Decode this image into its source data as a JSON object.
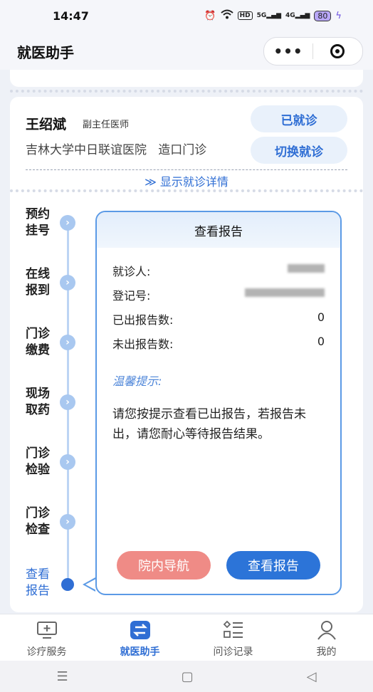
{
  "status_bar": {
    "time": "14:47",
    "hd": "HD",
    "net1": "5G",
    "net2": "4G",
    "battery": "80"
  },
  "nav": {
    "title": "就医助手",
    "more": "•••"
  },
  "doctor": {
    "name": "王绍斌",
    "title": "副主任医师",
    "hospital": "吉林大学中日联谊医院   造口门诊",
    "status_button": "已就诊",
    "switch_button": "切换就诊",
    "show_detail": "≫ 显示就诊详情"
  },
  "steps": [
    {
      "line1": "预约",
      "line2": "挂号"
    },
    {
      "line1": "在线",
      "line2": "报到"
    },
    {
      "line1": "门诊",
      "line2": "缴费"
    },
    {
      "line1": "现场",
      "line2": "取药"
    },
    {
      "line1": "门诊",
      "line2": "检验"
    },
    {
      "line1": "门诊",
      "line2": "检查"
    },
    {
      "line1": "查看",
      "line2": "报告"
    }
  ],
  "report": {
    "title": "查看报告",
    "patient_label": "就诊人:",
    "reg_label": "登记号:",
    "issued_label": "已出报告数:",
    "issued_count": "0",
    "pending_label": "未出报告数:",
    "pending_count": "0",
    "tip_title": "温馨提示:",
    "tip_text": "请您按提示查看已出报告，若报告未出，请您耐心等待报告结果。",
    "nav_button": "院内导航",
    "report_button": "查看报告"
  },
  "tabs": [
    {
      "label": "诊疗服务"
    },
    {
      "label": "就医助手"
    },
    {
      "label": "问诊记录"
    },
    {
      "label": "我的"
    }
  ],
  "system_nav": {
    "menu": "☰",
    "home": "▢",
    "back": "◁"
  },
  "colors": {
    "accent": "#2f6ed4",
    "nav_button": "#ef8b86",
    "report_button": "#2c74d8"
  }
}
